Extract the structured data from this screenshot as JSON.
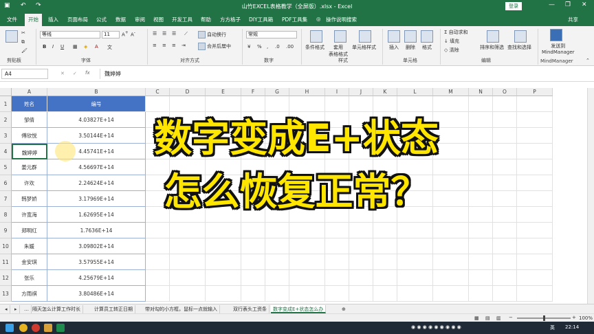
{
  "window": {
    "title": "山竹EXCEL表格教学（全屏版）.xlsx  -  Excel",
    "login_label": "登录",
    "share_label": "共享",
    "min_glyph": "—",
    "restore_glyph": "❐",
    "close_glyph": "✕"
  },
  "tabs": [
    "文件",
    "开始",
    "插入",
    "页面布局",
    "公式",
    "数据",
    "审阅",
    "视图",
    "开发工具",
    "帮助",
    "方方格子",
    "DIY工具箱",
    "PDF工具集",
    "操作说明搜索"
  ],
  "ribbon": {
    "font_name": "等线",
    "font_size": "11",
    "wrap_text": "自动换行",
    "merge_center": "合并后居中",
    "number_format": "常规",
    "cond_format": "条件格式",
    "table_format": "套用\n表格格式",
    "cell_style": "单元格样式",
    "insert": "插入",
    "delete": "删除",
    "format": "格式",
    "autosum": "自动求和",
    "fill": "填充",
    "clear": "清除",
    "sort_filter": "排序和筛选",
    "find_select": "查找和选择",
    "send_mindmanager": "发送到\nMindManager",
    "groups": {
      "clipboard": "剪贴板",
      "font": "字体",
      "alignment": "对齐方式",
      "number": "数字",
      "styles": "样式",
      "cells": "单元格",
      "editing": "编辑",
      "mindmanager": "MindManager"
    }
  },
  "formula_bar": {
    "name_box": "A4",
    "content": "魏婷婷"
  },
  "columns": [
    "A",
    "B",
    "C",
    "D",
    "E",
    "F",
    "G",
    "H",
    "I",
    "J",
    "K",
    "L",
    "M",
    "N",
    "O",
    "P"
  ],
  "rows": [
    "1",
    "2",
    "3",
    "4",
    "5",
    "6",
    "7",
    "8",
    "9",
    "10",
    "11",
    "12",
    "13"
  ],
  "table": {
    "headers": [
      "姓名",
      "编号"
    ],
    "data": [
      [
        "邹倩",
        "4.03827E+14"
      ],
      [
        "傅欣悦",
        "3.50144E+14"
      ],
      [
        "魏婷婷",
        "4.45741E+14"
      ],
      [
        "姜元群",
        "4.56697E+14"
      ],
      [
        "许欢",
        "2.24624E+14"
      ],
      [
        "韩梦娇",
        "3.17969E+14"
      ],
      [
        "许宽海",
        "1.62695E+14"
      ],
      [
        "郑明红",
        "1.7636E+14"
      ],
      [
        "朱媛",
        "3.09802E+14"
      ],
      [
        "金安琪",
        "3.57955E+14"
      ],
      [
        "张乐",
        "4.25679E+14"
      ],
      [
        "方雨祺",
        "3.80486E+14"
      ]
    ]
  },
  "overlay": {
    "line1": "数字变成E+状态",
    "line2": "怎么恢复正常？"
  },
  "sheet_tabs": [
    "隔天怎么计算工作时长",
    "计算员工转正日期",
    "带对勾的小方框，鼠标一点就输入",
    "双行表头工资条",
    "数字变成E+状态怎么办"
  ],
  "active_sheet_index": 4,
  "status": {
    "zoom": "100%"
  },
  "taskbar": {
    "time": "22:14",
    "ime": "英"
  }
}
